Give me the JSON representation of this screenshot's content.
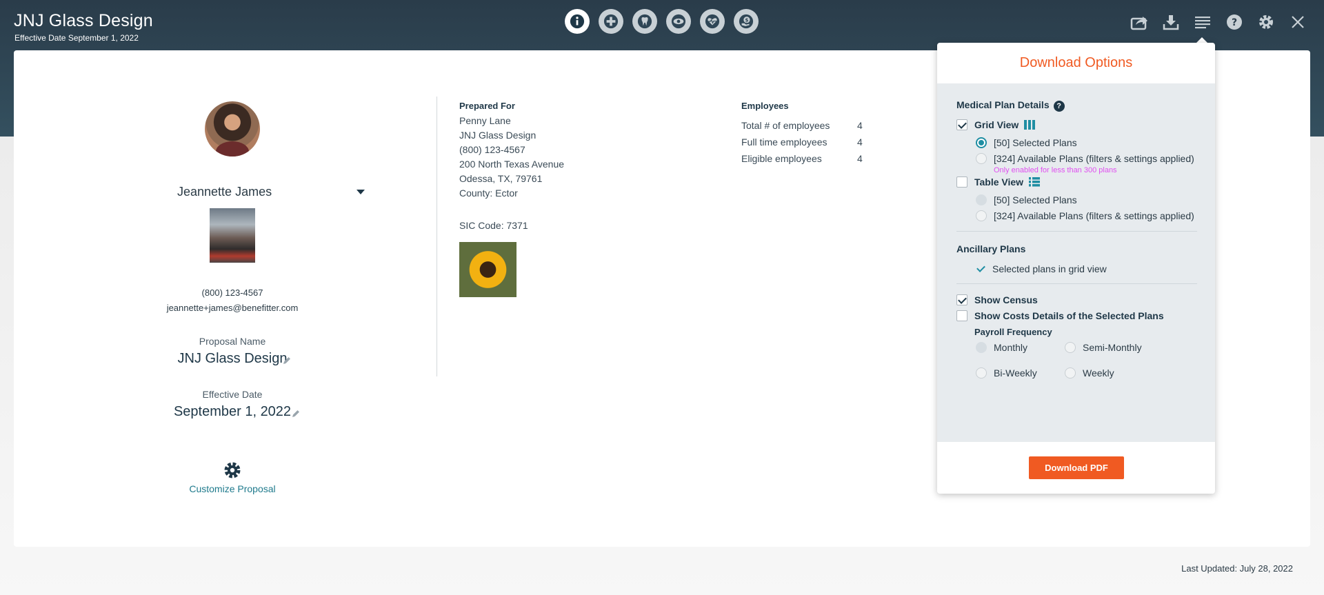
{
  "header": {
    "title": "JNJ Glass Design",
    "subtitle": "Effective Date September 1, 2022"
  },
  "nav_icons": [
    "info-icon",
    "medical-plus-icon",
    "tooth-icon",
    "eye-icon",
    "heart-pulse-icon",
    "dollar-hand-icon"
  ],
  "tools": [
    "share-icon",
    "download-icon",
    "menu-icon",
    "help-icon",
    "gear-icon",
    "close-icon"
  ],
  "profile": {
    "name": "Jeannette James",
    "phone": "(800) 123-4567",
    "email": "jeannette+james@benefitter.com",
    "proposal_name_label": "Proposal Name",
    "proposal_name": "JNJ Glass Design",
    "effective_date_label": "Effective Date",
    "effective_date": "September 1, 2022",
    "customize_label": "Customize Proposal"
  },
  "prepared_for": {
    "title": "Prepared For",
    "lines": [
      "Penny Lane",
      "JNJ Glass Design",
      "(800) 123-4567",
      "200 North Texas Avenue",
      "Odessa, TX, 79761",
      "County: Ector"
    ],
    "sic": "SIC Code: 7371"
  },
  "employees": {
    "title": "Employees",
    "rows": [
      {
        "label": "Total # of employees",
        "value": "4"
      },
      {
        "label": "Full time employees",
        "value": "4"
      },
      {
        "label": "Eligible employees",
        "value": "4"
      }
    ]
  },
  "download_options": {
    "title": "Download Options",
    "medical_title": "Medical Plan Details",
    "grid_view_label": "Grid View",
    "grid_selected": "[50] Selected Plans",
    "grid_available": "[324] Available Plans (filters & settings applied)",
    "grid_note": "Only enabled for less than 300 plans",
    "table_view_label": "Table View",
    "table_selected": "[50] Selected Plans",
    "table_available": "[324] Available Plans (filters & settings applied)",
    "ancillary_title": "Ancillary Plans",
    "ancillary_item": "Selected plans in grid view",
    "show_census": "Show Census",
    "show_costs": "Show Costs Details of the Selected Plans",
    "payroll_title": "Payroll Frequency",
    "payroll_options": [
      "Monthly",
      "Semi-Monthly",
      "Bi-Weekly",
      "Weekly"
    ],
    "button": "Download PDF"
  },
  "footer": {
    "last_updated": "Last Updated: July 28, 2022"
  },
  "colors": {
    "accent": "#f05a22",
    "teal": "#1f8ea3",
    "header_dark": "#2a3c4a"
  }
}
